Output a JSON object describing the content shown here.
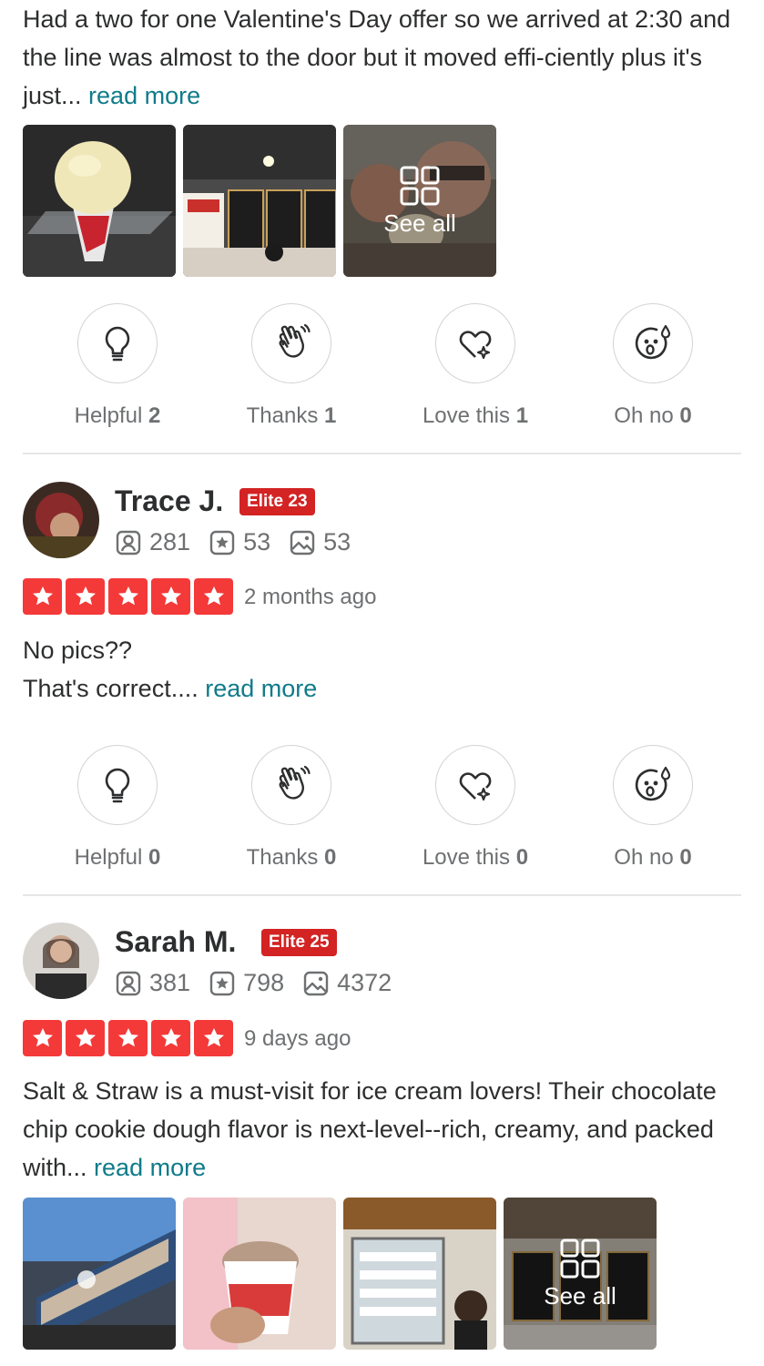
{
  "review1": {
    "text": "Had a two for one Valentine's Day offer so we arrived at 2:30 and the line was almost to the door but it moved effi-ciently plus it's just...",
    "read_more": "read more",
    "see_all": "See all",
    "reactions": {
      "helpful_label": "Helpful",
      "helpful_count": "2",
      "thanks_label": "Thanks",
      "thanks_count": "1",
      "love_label": "Love this",
      "love_count": "1",
      "ohno_label": "Oh no",
      "ohno_count": "0"
    }
  },
  "review2": {
    "name": "Trace J.",
    "elite": "Elite 23",
    "friends": "281",
    "reviews": "53",
    "photos": "53",
    "date": "2 months ago",
    "text_line1": "No pics??",
    "text_line2": "That's correct....",
    "read_more": "read more",
    "reactions": {
      "helpful_label": "Helpful",
      "helpful_count": "0",
      "thanks_label": "Thanks",
      "thanks_count": "0",
      "love_label": "Love this",
      "love_count": "0",
      "ohno_label": "Oh no",
      "ohno_count": "0"
    }
  },
  "review3": {
    "name": "Sarah M.",
    "elite": "Elite 25",
    "friends": "381",
    "reviews": "798",
    "photos": "4372",
    "date": "9 days ago",
    "text": "Salt & Straw is a must-visit for ice cream lovers! Their chocolate chip cookie dough flavor is next-level--rich, creamy, and packed with...",
    "read_more": "read more",
    "see_all": "See all"
  },
  "colors": {
    "star_red": "#f43939",
    "elite_red": "#d32323",
    "link_teal": "#0f7b8a",
    "muted_gray": "#6e7072"
  },
  "icons": [
    "lightbulb-icon",
    "wave-hand-icon",
    "heart-sparkle-icon",
    "surprised-face-icon",
    "friends-icon",
    "review-star-icon",
    "photo-icon",
    "grid-icon",
    "star-icon"
  ]
}
